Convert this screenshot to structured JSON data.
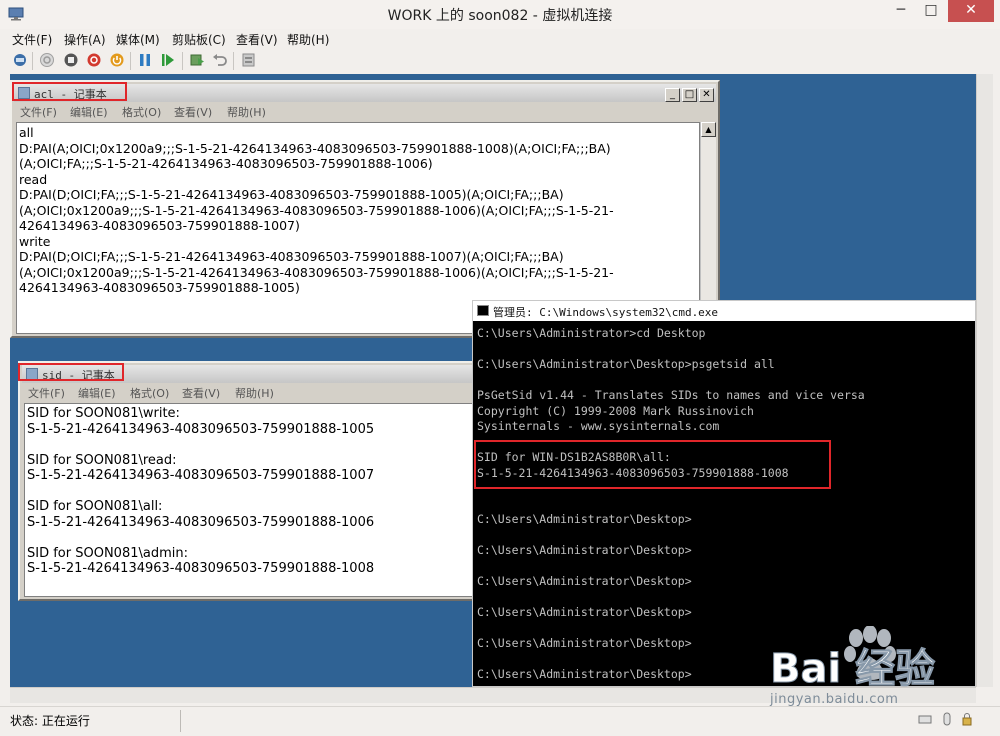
{
  "window": {
    "title": "WORK 上的 soon082 - 虚拟机连接",
    "min": "─",
    "max": "□",
    "close": "✕"
  },
  "menu": [
    "文件(F)",
    "操作(A)",
    "媒体(M)",
    "剪贴板(C)",
    "查看(V)",
    "帮助(H)"
  ],
  "toolbar_icons": [
    "ctrl-alt-del-icon",
    "start-icon",
    "turn-off-icon",
    "shutdown-icon",
    "power-icon",
    "pause-icon",
    "resume-icon",
    "snapshot-icon",
    "revert-icon",
    "settings-icon"
  ],
  "status": {
    "text": "状态: 正在运行"
  },
  "acl_notepad": {
    "title": "acl - 记事本",
    "menu": [
      "文件(F)",
      "编辑(E)",
      "格式(O)",
      "查看(V)",
      "帮助(H)"
    ],
    "lines": [
      "all",
      "D:PAI(A;OICI;0x1200a9;;;S-1-5-21-4264134963-4083096503-759901888-1008)(A;OICI;FA;;;BA)",
      "(A;OICI;FA;;;S-1-5-21-4264134963-4083096503-759901888-1006)",
      "read",
      "D:PAI(D;OICI;FA;;;S-1-5-21-4264134963-4083096503-759901888-1005)(A;OICI;FA;;;BA)",
      "(A;OICI;0x1200a9;;;S-1-5-21-4264134963-4083096503-759901888-1006)(A;OICI;FA;;;S-1-5-21-",
      "4264134963-4083096503-759901888-1007)",
      "write",
      "D:PAI(D;OICI;FA;;;S-1-5-21-4264134963-4083096503-759901888-1007)(A;OICI;FA;;;BA)",
      "(A;OICI;0x1200a9;;;S-1-5-21-4264134963-4083096503-759901888-1006)(A;OICI;FA;;;S-1-5-21-",
      "4264134963-4083096503-759901888-1005)"
    ]
  },
  "sid_notepad": {
    "title": "sid - 记事本",
    "menu": [
      "文件(F)",
      "编辑(E)",
      "格式(O)",
      "查看(V)",
      "帮助(H)"
    ],
    "lines": [
      "SID for SOON081\\write:",
      "S-1-5-21-4264134963-4083096503-759901888-1005",
      "",
      "SID for SOON081\\read:",
      "S-1-5-21-4264134963-4083096503-759901888-1007",
      "",
      "SID for SOON081\\all:",
      "S-1-5-21-4264134963-4083096503-759901888-1006",
      "",
      "SID for SOON081\\admin:",
      "S-1-5-21-4264134963-4083096503-759901888-1008"
    ]
  },
  "cmd": {
    "title": "管理员: C:\\Windows\\system32\\cmd.exe",
    "lines": [
      "C:\\Users\\Administrator>cd Desktop",
      "",
      "C:\\Users\\Administrator\\Desktop>psgetsid all",
      "",
      "PsGetSid v1.44 - Translates SIDs to names and vice versa",
      "Copyright (C) 1999-2008 Mark Russinovich",
      "Sysinternals - www.sysinternals.com",
      "",
      "SID for WIN-DS1B2AS8B0R\\all:",
      "S-1-5-21-4264134963-4083096503-759901888-1008",
      "",
      "",
      "C:\\Users\\Administrator\\Desktop>",
      "",
      "C:\\Users\\Administrator\\Desktop>",
      "",
      "C:\\Users\\Administrator\\Desktop>",
      "",
      "C:\\Users\\Administrator\\Desktop>",
      "",
      "C:\\Users\\Administrator\\Desktop>",
      "",
      "C:\\Users\\Administrator\\Desktop>"
    ]
  },
  "watermark": {
    "logo": "Bai 经验",
    "url": "jingyan.baidu.com"
  },
  "colors": {
    "desktop": "#2f6294",
    "highlight_box": "#e0262a",
    "close_button": "#c75050"
  }
}
